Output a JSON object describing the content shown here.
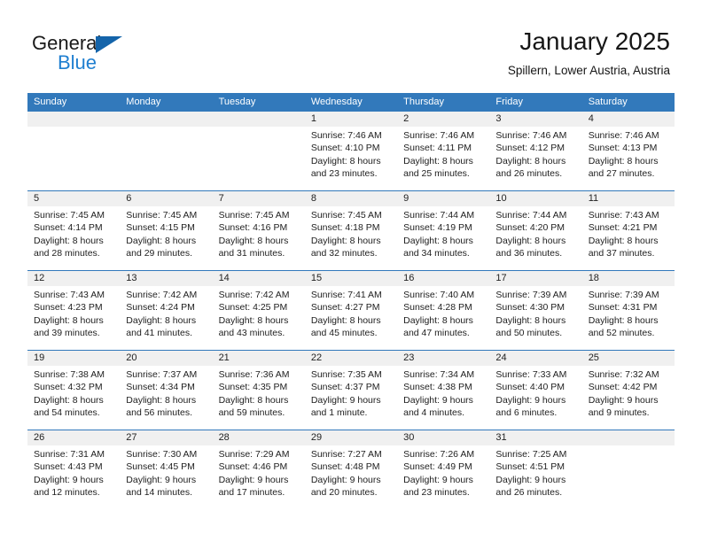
{
  "brand": {
    "word1": "General",
    "word2": "Blue",
    "accent_blue": "#1f7fd0",
    "triangle_blue": "#1464aa"
  },
  "header": {
    "title": "January 2025",
    "location": "Spillern, Lower Austria, Austria"
  },
  "theme": {
    "header_band": "#3279bb",
    "daynum_band": "#f0f0f0",
    "text": "#1e1e1e"
  },
  "weekdays": [
    "Sunday",
    "Monday",
    "Tuesday",
    "Wednesday",
    "Thursday",
    "Friday",
    "Saturday"
  ],
  "weeks": [
    [
      {
        "day": "",
        "sunrise": "",
        "sunset": "",
        "daylight1": "",
        "daylight2": ""
      },
      {
        "day": "",
        "sunrise": "",
        "sunset": "",
        "daylight1": "",
        "daylight2": ""
      },
      {
        "day": "",
        "sunrise": "",
        "sunset": "",
        "daylight1": "",
        "daylight2": ""
      },
      {
        "day": "1",
        "sunrise": "Sunrise: 7:46 AM",
        "sunset": "Sunset: 4:10 PM",
        "daylight1": "Daylight: 8 hours",
        "daylight2": "and 23 minutes."
      },
      {
        "day": "2",
        "sunrise": "Sunrise: 7:46 AM",
        "sunset": "Sunset: 4:11 PM",
        "daylight1": "Daylight: 8 hours",
        "daylight2": "and 25 minutes."
      },
      {
        "day": "3",
        "sunrise": "Sunrise: 7:46 AM",
        "sunset": "Sunset: 4:12 PM",
        "daylight1": "Daylight: 8 hours",
        "daylight2": "and 26 minutes."
      },
      {
        "day": "4",
        "sunrise": "Sunrise: 7:46 AM",
        "sunset": "Sunset: 4:13 PM",
        "daylight1": "Daylight: 8 hours",
        "daylight2": "and 27 minutes."
      }
    ],
    [
      {
        "day": "5",
        "sunrise": "Sunrise: 7:45 AM",
        "sunset": "Sunset: 4:14 PM",
        "daylight1": "Daylight: 8 hours",
        "daylight2": "and 28 minutes."
      },
      {
        "day": "6",
        "sunrise": "Sunrise: 7:45 AM",
        "sunset": "Sunset: 4:15 PM",
        "daylight1": "Daylight: 8 hours",
        "daylight2": "and 29 minutes."
      },
      {
        "day": "7",
        "sunrise": "Sunrise: 7:45 AM",
        "sunset": "Sunset: 4:16 PM",
        "daylight1": "Daylight: 8 hours",
        "daylight2": "and 31 minutes."
      },
      {
        "day": "8",
        "sunrise": "Sunrise: 7:45 AM",
        "sunset": "Sunset: 4:18 PM",
        "daylight1": "Daylight: 8 hours",
        "daylight2": "and 32 minutes."
      },
      {
        "day": "9",
        "sunrise": "Sunrise: 7:44 AM",
        "sunset": "Sunset: 4:19 PM",
        "daylight1": "Daylight: 8 hours",
        "daylight2": "and 34 minutes."
      },
      {
        "day": "10",
        "sunrise": "Sunrise: 7:44 AM",
        "sunset": "Sunset: 4:20 PM",
        "daylight1": "Daylight: 8 hours",
        "daylight2": "and 36 minutes."
      },
      {
        "day": "11",
        "sunrise": "Sunrise: 7:43 AM",
        "sunset": "Sunset: 4:21 PM",
        "daylight1": "Daylight: 8 hours",
        "daylight2": "and 37 minutes."
      }
    ],
    [
      {
        "day": "12",
        "sunrise": "Sunrise: 7:43 AM",
        "sunset": "Sunset: 4:23 PM",
        "daylight1": "Daylight: 8 hours",
        "daylight2": "and 39 minutes."
      },
      {
        "day": "13",
        "sunrise": "Sunrise: 7:42 AM",
        "sunset": "Sunset: 4:24 PM",
        "daylight1": "Daylight: 8 hours",
        "daylight2": "and 41 minutes."
      },
      {
        "day": "14",
        "sunrise": "Sunrise: 7:42 AM",
        "sunset": "Sunset: 4:25 PM",
        "daylight1": "Daylight: 8 hours",
        "daylight2": "and 43 minutes."
      },
      {
        "day": "15",
        "sunrise": "Sunrise: 7:41 AM",
        "sunset": "Sunset: 4:27 PM",
        "daylight1": "Daylight: 8 hours",
        "daylight2": "and 45 minutes."
      },
      {
        "day": "16",
        "sunrise": "Sunrise: 7:40 AM",
        "sunset": "Sunset: 4:28 PM",
        "daylight1": "Daylight: 8 hours",
        "daylight2": "and 47 minutes."
      },
      {
        "day": "17",
        "sunrise": "Sunrise: 7:39 AM",
        "sunset": "Sunset: 4:30 PM",
        "daylight1": "Daylight: 8 hours",
        "daylight2": "and 50 minutes."
      },
      {
        "day": "18",
        "sunrise": "Sunrise: 7:39 AM",
        "sunset": "Sunset: 4:31 PM",
        "daylight1": "Daylight: 8 hours",
        "daylight2": "and 52 minutes."
      }
    ],
    [
      {
        "day": "19",
        "sunrise": "Sunrise: 7:38 AM",
        "sunset": "Sunset: 4:32 PM",
        "daylight1": "Daylight: 8 hours",
        "daylight2": "and 54 minutes."
      },
      {
        "day": "20",
        "sunrise": "Sunrise: 7:37 AM",
        "sunset": "Sunset: 4:34 PM",
        "daylight1": "Daylight: 8 hours",
        "daylight2": "and 56 minutes."
      },
      {
        "day": "21",
        "sunrise": "Sunrise: 7:36 AM",
        "sunset": "Sunset: 4:35 PM",
        "daylight1": "Daylight: 8 hours",
        "daylight2": "and 59 minutes."
      },
      {
        "day": "22",
        "sunrise": "Sunrise: 7:35 AM",
        "sunset": "Sunset: 4:37 PM",
        "daylight1": "Daylight: 9 hours",
        "daylight2": "and 1 minute."
      },
      {
        "day": "23",
        "sunrise": "Sunrise: 7:34 AM",
        "sunset": "Sunset: 4:38 PM",
        "daylight1": "Daylight: 9 hours",
        "daylight2": "and 4 minutes."
      },
      {
        "day": "24",
        "sunrise": "Sunrise: 7:33 AM",
        "sunset": "Sunset: 4:40 PM",
        "daylight1": "Daylight: 9 hours",
        "daylight2": "and 6 minutes."
      },
      {
        "day": "25",
        "sunrise": "Sunrise: 7:32 AM",
        "sunset": "Sunset: 4:42 PM",
        "daylight1": "Daylight: 9 hours",
        "daylight2": "and 9 minutes."
      }
    ],
    [
      {
        "day": "26",
        "sunrise": "Sunrise: 7:31 AM",
        "sunset": "Sunset: 4:43 PM",
        "daylight1": "Daylight: 9 hours",
        "daylight2": "and 12 minutes."
      },
      {
        "day": "27",
        "sunrise": "Sunrise: 7:30 AM",
        "sunset": "Sunset: 4:45 PM",
        "daylight1": "Daylight: 9 hours",
        "daylight2": "and 14 minutes."
      },
      {
        "day": "28",
        "sunrise": "Sunrise: 7:29 AM",
        "sunset": "Sunset: 4:46 PM",
        "daylight1": "Daylight: 9 hours",
        "daylight2": "and 17 minutes."
      },
      {
        "day": "29",
        "sunrise": "Sunrise: 7:27 AM",
        "sunset": "Sunset: 4:48 PM",
        "daylight1": "Daylight: 9 hours",
        "daylight2": "and 20 minutes."
      },
      {
        "day": "30",
        "sunrise": "Sunrise: 7:26 AM",
        "sunset": "Sunset: 4:49 PM",
        "daylight1": "Daylight: 9 hours",
        "daylight2": "and 23 minutes."
      },
      {
        "day": "31",
        "sunrise": "Sunrise: 7:25 AM",
        "sunset": "Sunset: 4:51 PM",
        "daylight1": "Daylight: 9 hours",
        "daylight2": "and 26 minutes."
      },
      {
        "day": "",
        "sunrise": "",
        "sunset": "",
        "daylight1": "",
        "daylight2": ""
      }
    ]
  ]
}
